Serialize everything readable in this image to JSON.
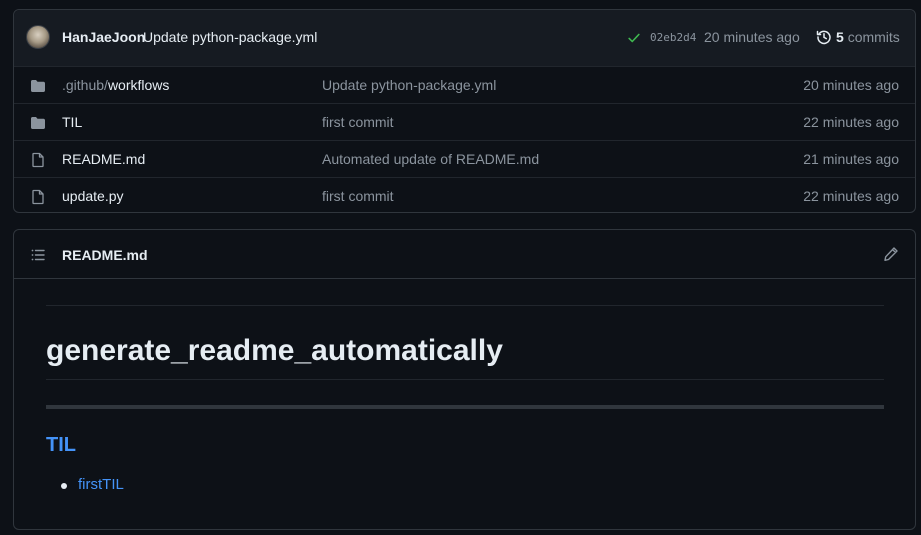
{
  "latest_commit": {
    "author": "HanJaeJoon",
    "message": "Update python-package.yml",
    "sha": "02eb2d4",
    "time": "20 minutes ago",
    "commits_count": "5",
    "commits_label": "commits"
  },
  "files": [
    {
      "type": "folder",
      "prefix": ".github/",
      "name": "workflows",
      "message": "Update python-package.yml",
      "age": "20 minutes ago"
    },
    {
      "type": "folder",
      "prefix": "",
      "name": "TIL",
      "message": "first commit",
      "age": "22 minutes ago"
    },
    {
      "type": "file",
      "prefix": "",
      "name": "README.md",
      "message": "Automated update of README.md",
      "age": "21 minutes ago"
    },
    {
      "type": "file",
      "prefix": "",
      "name": "update.py",
      "message": "first commit",
      "age": "22 minutes ago"
    }
  ],
  "readme": {
    "filename": "README.md",
    "heading": "generate_readme_automatically",
    "subheading": "TIL",
    "list": [
      "firstTIL"
    ]
  },
  "colors": {
    "background": "#0d1117",
    "link": "#4493f8",
    "success": "#3fb950",
    "muted": "#8b949e"
  },
  "icons": [
    "check-icon",
    "history-icon",
    "folder-icon",
    "file-icon",
    "list-unordered-icon",
    "pencil-icon"
  ]
}
